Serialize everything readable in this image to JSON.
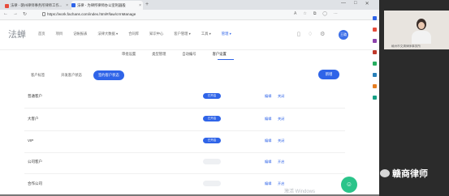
{
  "browser": {
    "tab1_title": "法律 - 赣州律师事务所律师工作...",
    "tab2_title": "法律 - 为律所律师办公室利器般",
    "new_tab": "+",
    "url": "https://work.fachans.com/index.html#/law/crmManage",
    "window_controls": [
      "—",
      "□",
      "✕"
    ]
  },
  "app": {
    "logo": "法蝉",
    "nav": [
      "首页",
      "项目",
      "记帐报表",
      "法律大数据 ▾",
      "合同库",
      "知识中心",
      "客户管理 ▾",
      "工具 ▾",
      "管理 ▾"
    ],
    "active_nav": "管理 ▾",
    "avatar": "王璐"
  },
  "settings": {
    "subtabs": [
      "审批设置",
      "类型管理",
      "自动编号",
      "客户设置"
    ],
    "active_subtab": "客户设置",
    "pill_tabs": [
      "客户标签",
      "开发客户状态",
      "签约客户状态"
    ],
    "active_pill": "签约客户状态",
    "add_button": "新增",
    "rows": [
      {
        "name": "普通客户",
        "status": "已开启",
        "enabled": true,
        "edit": "编辑",
        "toggle": "关闭"
      },
      {
        "name": "大客户",
        "status": "已开启",
        "enabled": true,
        "edit": "编辑",
        "toggle": "关闭"
      },
      {
        "name": "VIP",
        "status": "已开启",
        "enabled": true,
        "edit": "编辑",
        "toggle": "关闭"
      },
      {
        "name": "公司客户",
        "status": "已关闭",
        "enabled": false,
        "edit": "编辑",
        "toggle": "开启"
      },
      {
        "name": "合作公司",
        "status": "已关闭",
        "enabled": false,
        "edit": "编辑",
        "toggle": "开启"
      }
    ]
  },
  "overlay": {
    "watermark": "激活 Windows",
    "fab_icon": "chat-icon",
    "video_label": "赣州市文清律师事务所",
    "brand": "赣商律师"
  },
  "colors": {
    "accent": "#2f64e8",
    "fab": "#2bc48a",
    "dark_panel": "#2b2b2b"
  }
}
